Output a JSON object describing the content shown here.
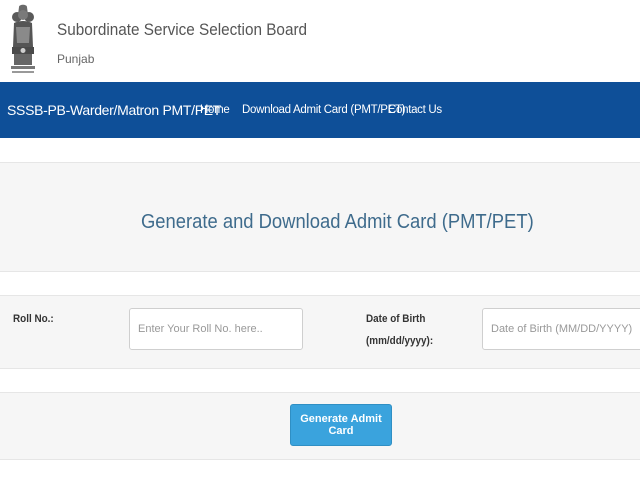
{
  "header": {
    "org_name": "Subordinate Service Selection Board",
    "org_sub": "Punjab",
    "emblem_icon": "state-emblem-icon"
  },
  "navbar": {
    "brand": "SSSB-PB-Warder/Matron PMT/PET",
    "links": [
      "Home",
      "Download Admit Card (PMT/PET)",
      "Contact Us"
    ],
    "background": "#0e4f98"
  },
  "main": {
    "title": "Generate and Download Admit Card (PMT/PET)",
    "form": {
      "roll_label": "Roll No.:",
      "roll_placeholder": "Enter Your Roll No. here..",
      "roll_value": "",
      "dob_label": "Date of Birth",
      "dob_format_label": "(mm/dd/yyyy):",
      "dob_placeholder": "Date of Birth (MM/DD/YYYY)",
      "dob_value": ""
    },
    "button_label": "Generate Admit Card",
    "button_color": "#3aa3dd"
  }
}
